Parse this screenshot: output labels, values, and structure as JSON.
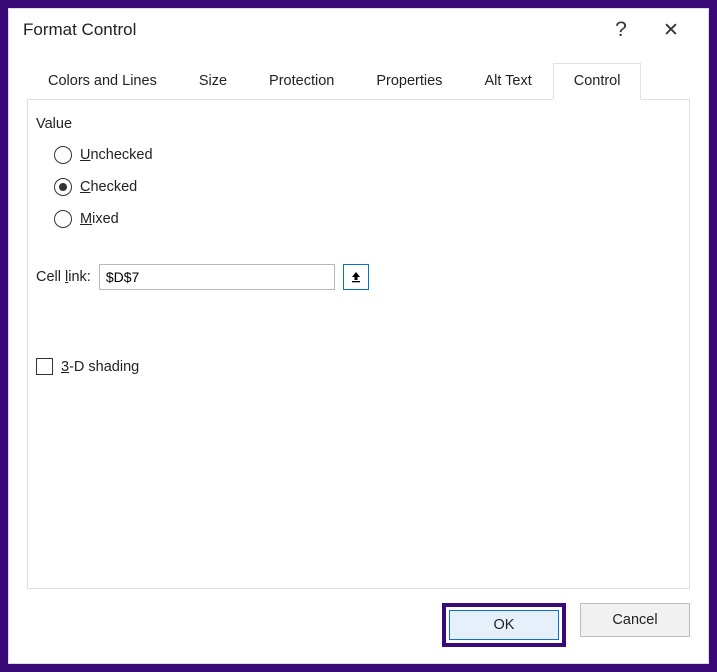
{
  "titlebar": {
    "title": "Format Control",
    "help": "?",
    "close": "✕"
  },
  "tabs": {
    "colors_lines": "Colors and Lines",
    "size": "Size",
    "protection": "Protection",
    "properties": "Properties",
    "alt_text": "Alt Text",
    "control": "Control"
  },
  "panel": {
    "value_label": "Value",
    "radio_unchecked": "Unchecked",
    "radio_checked": "Checked",
    "radio_mixed": "Mixed",
    "selected_value": "Checked",
    "cell_link_label": "Cell link:",
    "cell_link_value": "$D$7",
    "shading_label": "3-D shading",
    "shading_checked": false
  },
  "footer": {
    "ok": "OK",
    "cancel": "Cancel"
  }
}
